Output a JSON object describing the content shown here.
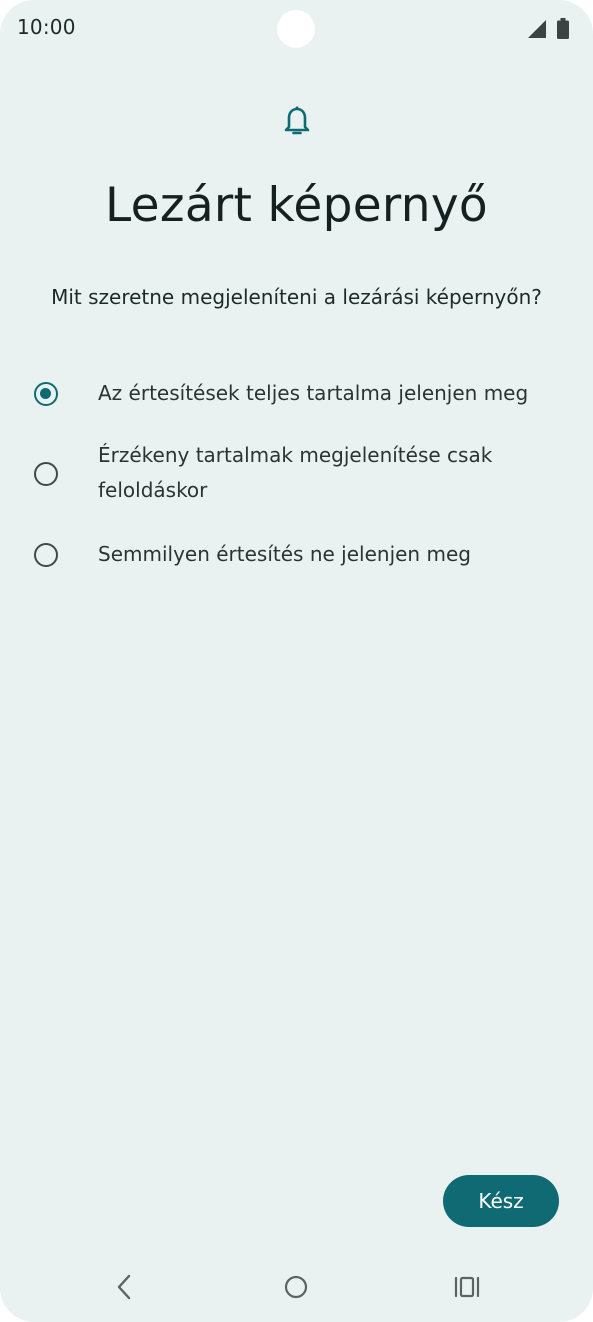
{
  "status_bar": {
    "time": "10:00",
    "icons": [
      "signal-icon",
      "battery-icon"
    ]
  },
  "header": {
    "icon": "bell-icon",
    "title": "Lezárt képernyő",
    "subtitle": "Mit szeretne megjeleníteni a lezárási képernyőn?"
  },
  "options": [
    {
      "label": "Az értesítések teljes tartalma jelenjen meg",
      "selected": true
    },
    {
      "label": "Érzékeny tartalmak megjelenítése csak feloldáskor",
      "selected": false
    },
    {
      "label": "Semmilyen értesítés ne jelenjen meg",
      "selected": false
    }
  ],
  "footer": {
    "done_label": "Kész"
  },
  "nav_bar": {
    "icons": [
      "back-icon",
      "home-icon",
      "recents-icon"
    ]
  },
  "colors": {
    "background": "#eaf2f1",
    "accent": "#0f6a74",
    "text": "#1d2a2a"
  }
}
